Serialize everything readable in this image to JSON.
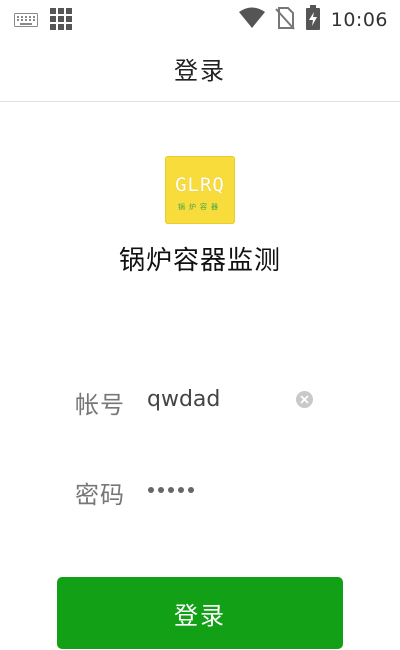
{
  "status_bar": {
    "time": "10:06",
    "icons": [
      "keyboard-icon",
      "grid-icon",
      "wifi-icon",
      "no-sim-icon",
      "battery-charging-icon"
    ]
  },
  "header": {
    "title": "登录"
  },
  "logo": {
    "text": "GLRQ",
    "subtext": "锅炉容器",
    "background": "#f8dc3c"
  },
  "app": {
    "name": "锅炉容器监测"
  },
  "form": {
    "account_label": "帐号",
    "account_value": "qwdad",
    "password_label": "密码",
    "password_length": 5
  },
  "login_button": {
    "label": "登录",
    "color": "#11a016"
  }
}
